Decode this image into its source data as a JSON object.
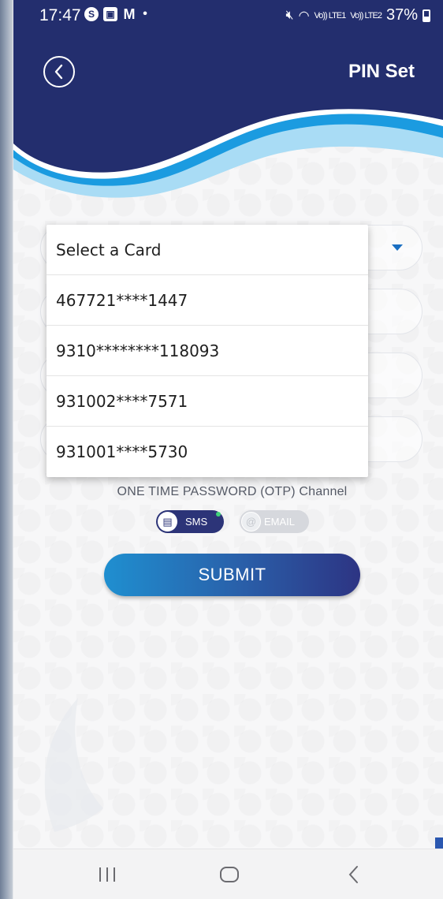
{
  "status_bar": {
    "time": "17:47",
    "battery": "37%",
    "signal_labels": [
      "Vo)) LTE1",
      "Vo)) LTE2"
    ]
  },
  "header": {
    "title": "PIN Set"
  },
  "dropdown": {
    "items": [
      "Select a Card",
      "467721****1447",
      "9310********118093",
      "931002****7571",
      "931001****5730"
    ]
  },
  "otp": {
    "label": "ONE TIME PASSWORD (OTP) Channel",
    "sms_label": "SMS",
    "email_label": "EMAIL",
    "selected": "SMS"
  },
  "submit_label": "SUBMIT",
  "colors": {
    "header_navy": "#232e6e",
    "wave_blue": "#1b9be0",
    "wave_light": "#a9dcf5",
    "accent_blue": "#1a6fc2",
    "toggle_active": "#2c3478"
  }
}
